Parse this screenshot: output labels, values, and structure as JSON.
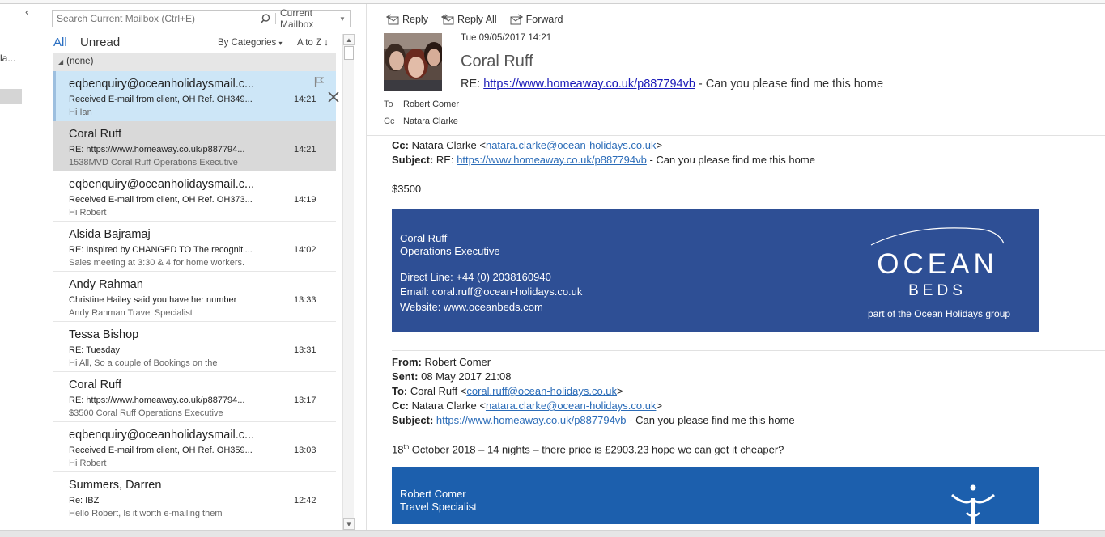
{
  "folder_pane": {
    "collapse_glyph": "‹",
    "partial_label": "la..."
  },
  "search": {
    "placeholder": "Search Current Mailbox (Ctrl+E)",
    "scope": "Current Mailbox"
  },
  "filters": {
    "all": "All",
    "unread": "Unread",
    "arrange": "By Categories",
    "sort": "A to Z"
  },
  "group": {
    "label": "(none)"
  },
  "messages": [
    {
      "sender": "eqbenquiry@oceanholidaysmail.c...",
      "subject": "Received E-mail from client, OH Ref. OH349...",
      "preview": "Hi Ian",
      "time": "14:21"
    },
    {
      "sender": "Coral Ruff",
      "subject": "RE: https://www.homeaway.co.uk/p887794...",
      "preview": "1538MVD  Coral Ruff  Operations Executive",
      "time": "14:21"
    },
    {
      "sender": "eqbenquiry@oceanholidaysmail.c...",
      "subject": "Received E-mail from client, OH Ref. OH373...",
      "preview": "Hi Robert",
      "time": "14:19"
    },
    {
      "sender": "Alsida Bajramaj",
      "subject": "RE: Inspired by CHANGED TO The recogniti...",
      "preview": "Sales meeting at 3:30 & 4 for home workers.",
      "time": "14:02"
    },
    {
      "sender": "Andy Rahman",
      "subject": "Christine Hailey said you have her number",
      "preview": "Andy Rahman  Travel Specialist",
      "time": "13:33"
    },
    {
      "sender": "Tessa Bishop",
      "subject": "RE: Tuesday",
      "preview": "Hi All,  So a couple of Bookings on the",
      "time": "13:31"
    },
    {
      "sender": "Coral Ruff",
      "subject": "RE: https://www.homeaway.co.uk/p887794...",
      "preview": "$3500  Coral Ruff  Operations Executive",
      "time": "13:17"
    },
    {
      "sender": "eqbenquiry@oceanholidaysmail.c...",
      "subject": "Received E-mail from client, OH Ref. OH359...",
      "preview": "Hi Robert",
      "time": "13:03"
    },
    {
      "sender": "Summers, Darren",
      "subject": "Re: IBZ",
      "preview": "Hello Robert,  Is it worth e-mailing them",
      "time": "12:42"
    }
  ],
  "reading": {
    "toolbar": {
      "reply": "Reply",
      "reply_all": "Reply All",
      "forward": "Forward"
    },
    "date": "Tue 09/05/2017 14:21",
    "sender": "Coral Ruff",
    "subject_prefix": "RE: ",
    "subject_link": "https://www.homeaway.co.uk/p887794vb",
    "subject_suffix": " - Can you please find me this home",
    "to_label": "To",
    "to": "Robert Comer",
    "cc_label": "Cc",
    "cc": "Natara Clarke"
  },
  "body": {
    "cc_line_label": "Cc:",
    "cc_line_name": " Natara Clarke <",
    "cc_line_email": "natara.clarke@ocean-holidays.co.uk",
    "cc_line_end": ">",
    "subject_label": "Subject:",
    "subject_prefix": " RE: ",
    "subject_link": "https://www.homeaway.co.uk/p887794vb",
    "subject_suffix": " - Can you please find me this home",
    "amount": "$3500",
    "signature": {
      "name": "Coral Ruff",
      "title": "Operations Executive",
      "direct_line": "Direct Line: +44 (0) 2038160940",
      "email": "Email: coral.ruff@ocean-holidays.co.uk",
      "website": "Website: www.oceanbeds.com",
      "logo_word1": "OCEAN",
      "logo_word2": "BEDS",
      "logo_tagline": "part of the Ocean Holidays group"
    },
    "quoted": {
      "from_label": "From:",
      "from": " Robert Comer",
      "sent_label": "Sent:",
      "sent": " 08 May 2017 21:08",
      "to_label": "To:",
      "to_name": " Coral Ruff <",
      "to_email": "coral.ruff@ocean-holidays.co.uk",
      "to_end": ">",
      "cc_label": "Cc:",
      "cc_name": " Natara Clarke <",
      "cc_email": "natara.clarke@ocean-holidays.co.uk",
      "cc_end": ">",
      "subject_label": "Subject:",
      "subject_link": "https://www.homeaway.co.uk/p887794vb",
      "subject_suffix": " - Can you please find me this home",
      "text_pre": "18",
      "text_sup": "th",
      "text_post": " October 2018 – 14 nights – there price is £2903.23 hope we can get it cheaper?"
    },
    "signature2": {
      "name": "Robert Comer",
      "title": "Travel Specialist"
    }
  },
  "colors": {
    "accent": "#2a6fc2",
    "selected_row": "#d9d9d9",
    "active_row": "#cde6f7",
    "signature_bg": "#2e4f95",
    "signature2_bg": "#1c5fad"
  }
}
